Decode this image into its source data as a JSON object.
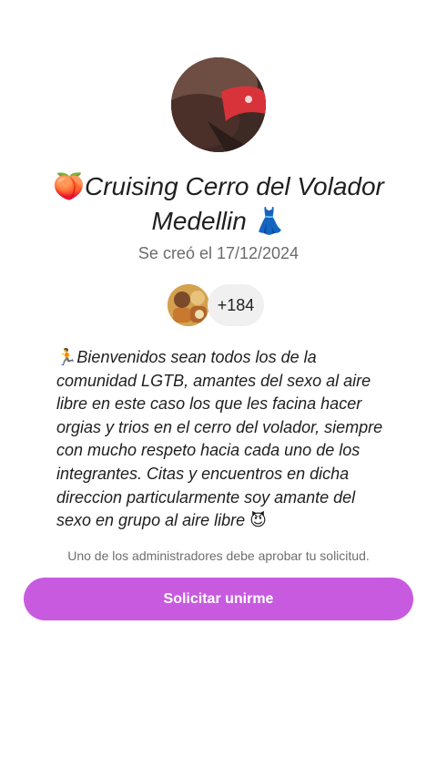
{
  "group": {
    "title_emoji_start": "🍑",
    "title_text": "Cruising Cerro del Volador Medellin",
    "title_emoji_end": "👗",
    "created_text": "Se creó el 17/12/2024"
  },
  "members": {
    "count_label": "+184"
  },
  "description": {
    "emoji_start": "🏃",
    "text": "Bienvenidos sean todos los de la comunidad LGTB, amantes del sexo al aire libre en este caso los que les facina hacer orgias y trios en el cerro del volador, siempre con mucho respeto hacia cada uno de los integrantes. Citas y encuentros en dicha direccion particularmente soy amante del sexo en grupo al aire libre",
    "emoji_end": "😈"
  },
  "join": {
    "approval_note": "Uno de los administradores debe aprobar tu solicitud.",
    "button_label": "Solicitar unirme",
    "button_color": "#c85ae0"
  },
  "icons": {
    "group_avatar": "group-avatar-photo",
    "member_avatar": "member-avatar-photo"
  }
}
